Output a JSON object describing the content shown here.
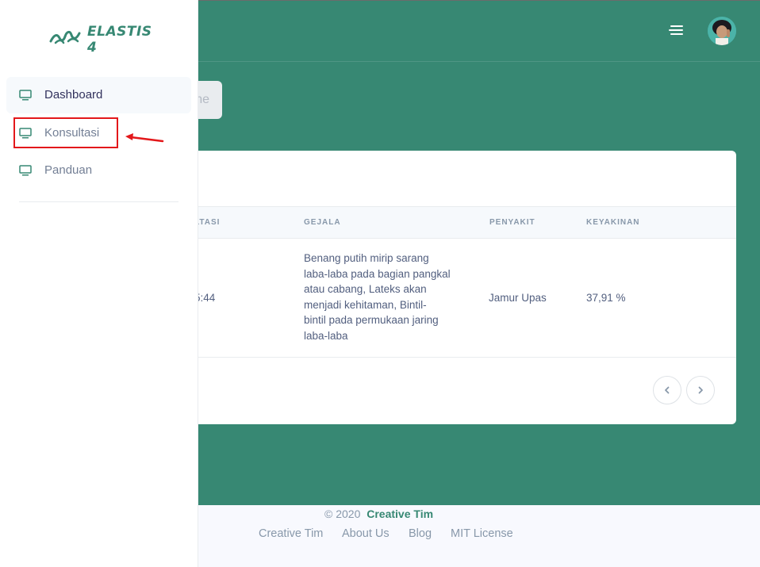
{
  "brand": {
    "name": "ELASTIS 4"
  },
  "sidebar": {
    "items": [
      {
        "label": "Dashboard",
        "active": true
      },
      {
        "label": "Konsultasi",
        "active": false
      },
      {
        "label": "Panduan",
        "active": false
      }
    ]
  },
  "search": {
    "partial_text": "ne"
  },
  "table": {
    "headers": [
      "LTASI",
      "GEJALA",
      "PENYAKIT",
      "KEYAKINAN"
    ],
    "rows": [
      {
        "time_partial": "5:44",
        "gejala_lines": [
          "Benang putih mirip sarang",
          "laba-laba pada bagian pangkal",
          "atau cabang, Lateks akan",
          "menjadi kehitaman, Bintil-",
          "bintil pada permukaan jaring",
          "laba-laba"
        ],
        "penyakit": "Jamur Upas",
        "keyakinan": "37,91 %"
      }
    ]
  },
  "pagination": {
    "prev_icon": "chevron-left-icon",
    "next_icon": "chevron-right-icon"
  },
  "footer": {
    "copyright": "© 2020",
    "brand": "Creative Tim",
    "links": [
      "Creative Tim",
      "About Us",
      "Blog",
      "MIT License"
    ]
  },
  "colors": {
    "primary": "#378873",
    "annotation": "#e3181b"
  }
}
